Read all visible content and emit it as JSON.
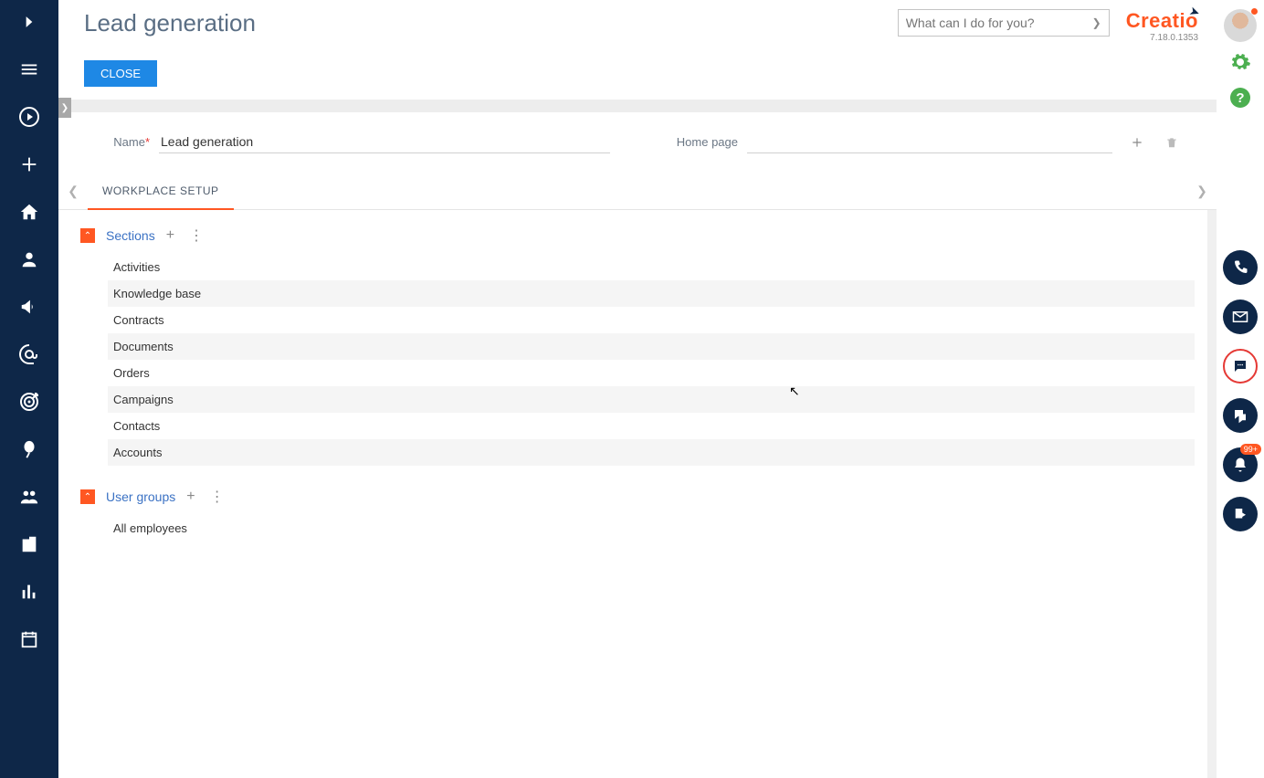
{
  "header": {
    "title": "Lead generation",
    "close_label": "CLOSE",
    "search_placeholder": "What can I do for you?",
    "brand_name": "Creatio",
    "version": "7.18.0.1353"
  },
  "form": {
    "name_label": "Name",
    "name_required_mark": "*",
    "name_value": "Lead generation",
    "homepage_label": "Home page",
    "homepage_value": ""
  },
  "tabs": {
    "active": "WORKPLACE SETUP"
  },
  "sections": {
    "title": "Sections",
    "items": [
      "Activities",
      "Knowledge base",
      "Contracts",
      "Documents",
      "Orders",
      "Campaigns",
      "Contacts",
      "Accounts"
    ]
  },
  "user_groups": {
    "title": "User groups",
    "items": [
      "All employees"
    ]
  },
  "right_rail": {
    "notification_badge": "99+"
  },
  "left_rail": {
    "icons": [
      "expand-icon",
      "menu-icon",
      "play-icon",
      "plus-icon",
      "home-icon",
      "person-icon",
      "megaphone-icon",
      "at-icon",
      "target-icon",
      "balloon-icon",
      "team-icon",
      "building-icon",
      "chart-icon",
      "calendar-icon"
    ]
  }
}
